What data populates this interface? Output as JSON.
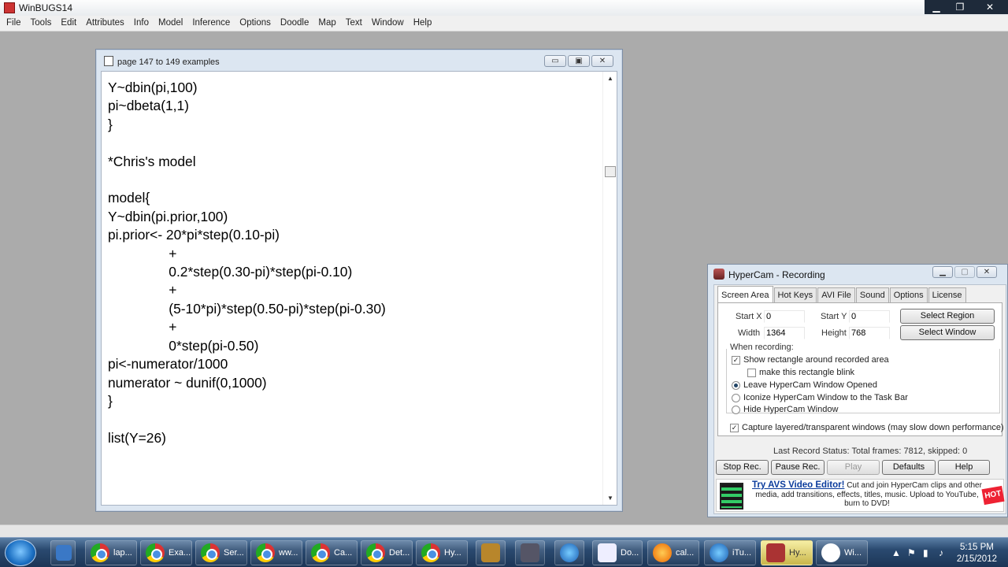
{
  "app": {
    "title": "WinBUGS14"
  },
  "menu": [
    "File",
    "Tools",
    "Edit",
    "Attributes",
    "Info",
    "Model",
    "Inference",
    "Options",
    "Doodle",
    "Map",
    "Text",
    "Window",
    "Help"
  ],
  "doc_window": {
    "title": "page 147 to 149 examples",
    "code_lines": [
      "Y~dbin(pi,100)",
      "pi~dbeta(1,1)",
      "}",
      "",
      "*Chris's model",
      "",
      "model{",
      "Y~dbin(pi.prior,100)",
      "pi.prior<- 20*pi*step(0.10-pi)",
      "                +",
      "                0.2*step(0.30-pi)*step(pi-0.10)",
      "                +",
      "                (5-10*pi)*step(0.50-pi)*step(pi-0.30)",
      "                +",
      "                0*step(pi-0.50)",
      "pi<-numerator/1000",
      "numerator ~ dunif(0,1000)",
      "}",
      "",
      "list(Y=26)"
    ]
  },
  "hypercam": {
    "title": "HyperCam - Recording",
    "tabs": [
      "Screen Area",
      "Hot Keys",
      "AVI File",
      "Sound",
      "Options",
      "License"
    ],
    "start_x_label": "Start X",
    "start_x": "0",
    "start_y_label": "Start Y",
    "start_y": "0",
    "width_label": "Width",
    "width": "1364",
    "height_label": "Height",
    "height": "768",
    "select_region": "Select Region",
    "select_window": "Select Window",
    "when_recording": "When recording:",
    "show_rect": "Show rectangle around recorded area",
    "blink": "make this rectangle blink",
    "leave_open": "Leave HyperCam Window Opened",
    "iconize": "Iconize HyperCam Window to the Task Bar",
    "hide": "Hide HyperCam Window",
    "capture_layered": "Capture layered/transparent windows (may slow down performance)",
    "status": "Last Record Status: Total frames: 7812, skipped: 0",
    "buttons": {
      "stop": "Stop Rec.",
      "pause": "Pause Rec.",
      "play": "Play",
      "defaults": "Defaults",
      "help": "Help"
    },
    "ad_link": "Try AVS Video Editor!",
    "ad_text": " Cut and join HyperCam clips and other media, add transitions, effects, titles, music. Upload to YouTube, burn to DVD!",
    "ad_badge": "HOT"
  },
  "taskbar": {
    "items": [
      "lap...",
      "Exa...",
      "Ser...",
      "ww...",
      "Ca...",
      "Det...",
      "Hy...",
      "",
      "",
      "",
      "Do...",
      "cal...",
      "iTu...",
      "Hy...",
      "Wi..."
    ],
    "time": "5:15 PM",
    "date": "2/15/2012"
  }
}
